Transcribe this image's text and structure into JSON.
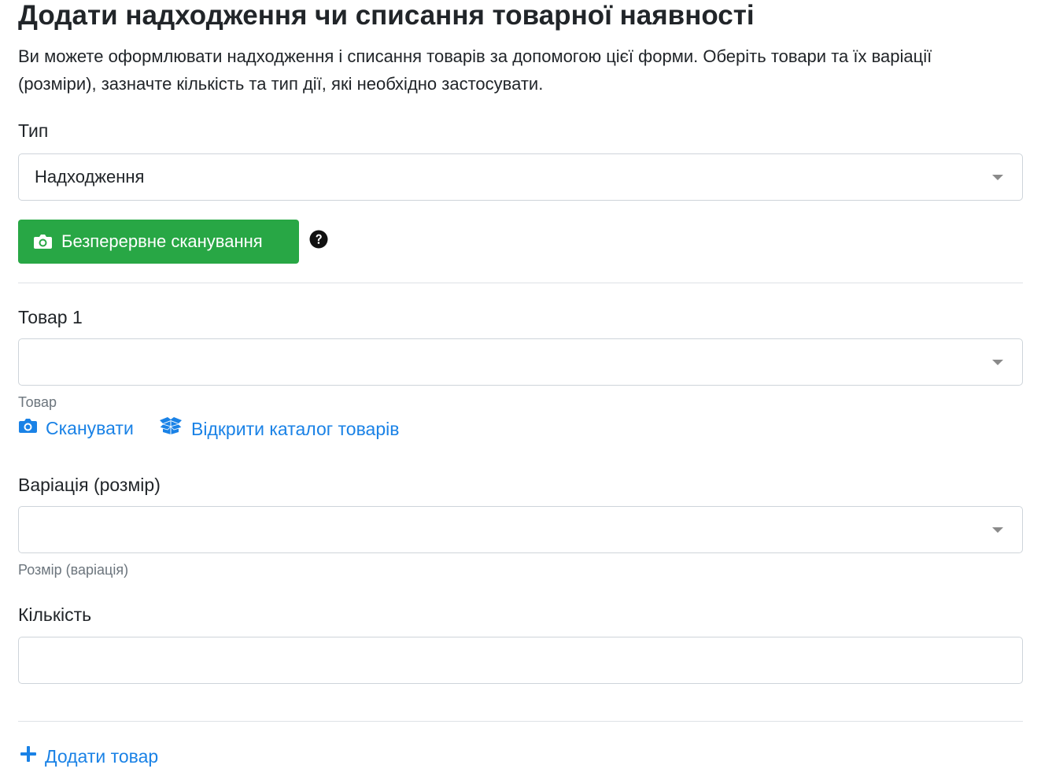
{
  "header": {
    "title": "Додати надходження чи списання товарної наявності",
    "description": "Ви можете оформлювати надходження і списання товарів за допомогою цієї форми. Оберіть товари та їх варіації (розміри), зазначте кількість та тип дії, які необхідно застосувати."
  },
  "type_field": {
    "label": "Тип",
    "value": "Надходження"
  },
  "continuous_scan_button": {
    "label": "Безперервне сканування",
    "icon": "camera-icon",
    "color": "#28a745"
  },
  "help_icon": "question-circle-icon",
  "product": {
    "label": "Товар 1",
    "value": "",
    "help": "Товар",
    "scan_link": "Сканувати",
    "catalog_link": "Відкрити каталог товарів"
  },
  "variation": {
    "label": "Варіація (розмір)",
    "value": "",
    "help": "Розмір (варіація)"
  },
  "quantity": {
    "label": "Кількість",
    "value": ""
  },
  "add_product_link": "Додати товар",
  "colors": {
    "link": "#1a82e6",
    "success": "#28a745",
    "border": "#ced4da",
    "muted": "#6c757d"
  }
}
